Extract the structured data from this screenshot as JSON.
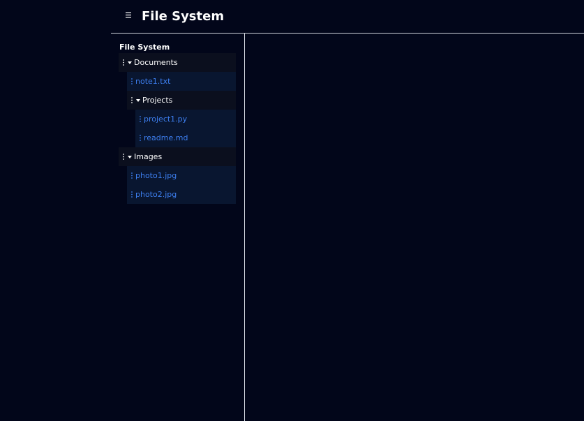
{
  "header": {
    "menu_icon": "hamburger-menu-icon",
    "title": "File System"
  },
  "sidebar": {
    "heading": "File System",
    "tree": [
      {
        "type": "folder",
        "label": "Documents",
        "depth": 0
      },
      {
        "type": "file",
        "label": "note1.txt",
        "depth": 1
      },
      {
        "type": "folder",
        "label": "Projects",
        "depth": 1
      },
      {
        "type": "file",
        "label": "project1.py",
        "depth": 2
      },
      {
        "type": "file",
        "label": "readme.md",
        "depth": 2
      },
      {
        "type": "folder",
        "label": "Images",
        "depth": 0
      },
      {
        "type": "file",
        "label": "photo1.jpg",
        "depth": 1
      },
      {
        "type": "file",
        "label": "photo2.jpg",
        "depth": 1
      }
    ]
  },
  "colors": {
    "background": "#02061a",
    "folder_row": "#0b0f1e",
    "file_row": "#091630",
    "file_text": "#3d7ff0",
    "divider": "#cfd3dc"
  }
}
